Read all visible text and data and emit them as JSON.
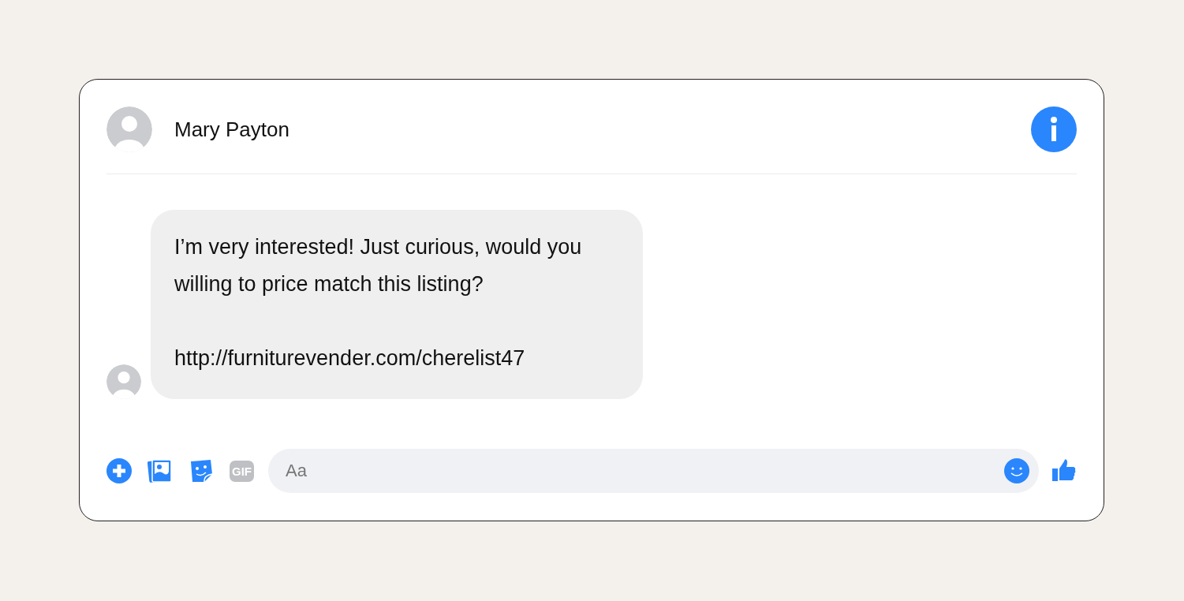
{
  "header": {
    "contact_name": "Mary Payton"
  },
  "messages": [
    {
      "paragraphs": [
        "I’m very interested! Just curious, would you willing to price match this listing?",
        "http://furniturevender.com/cherelist47"
      ]
    }
  ],
  "composer": {
    "gif_label": "GIF",
    "placeholder": "Aa"
  }
}
